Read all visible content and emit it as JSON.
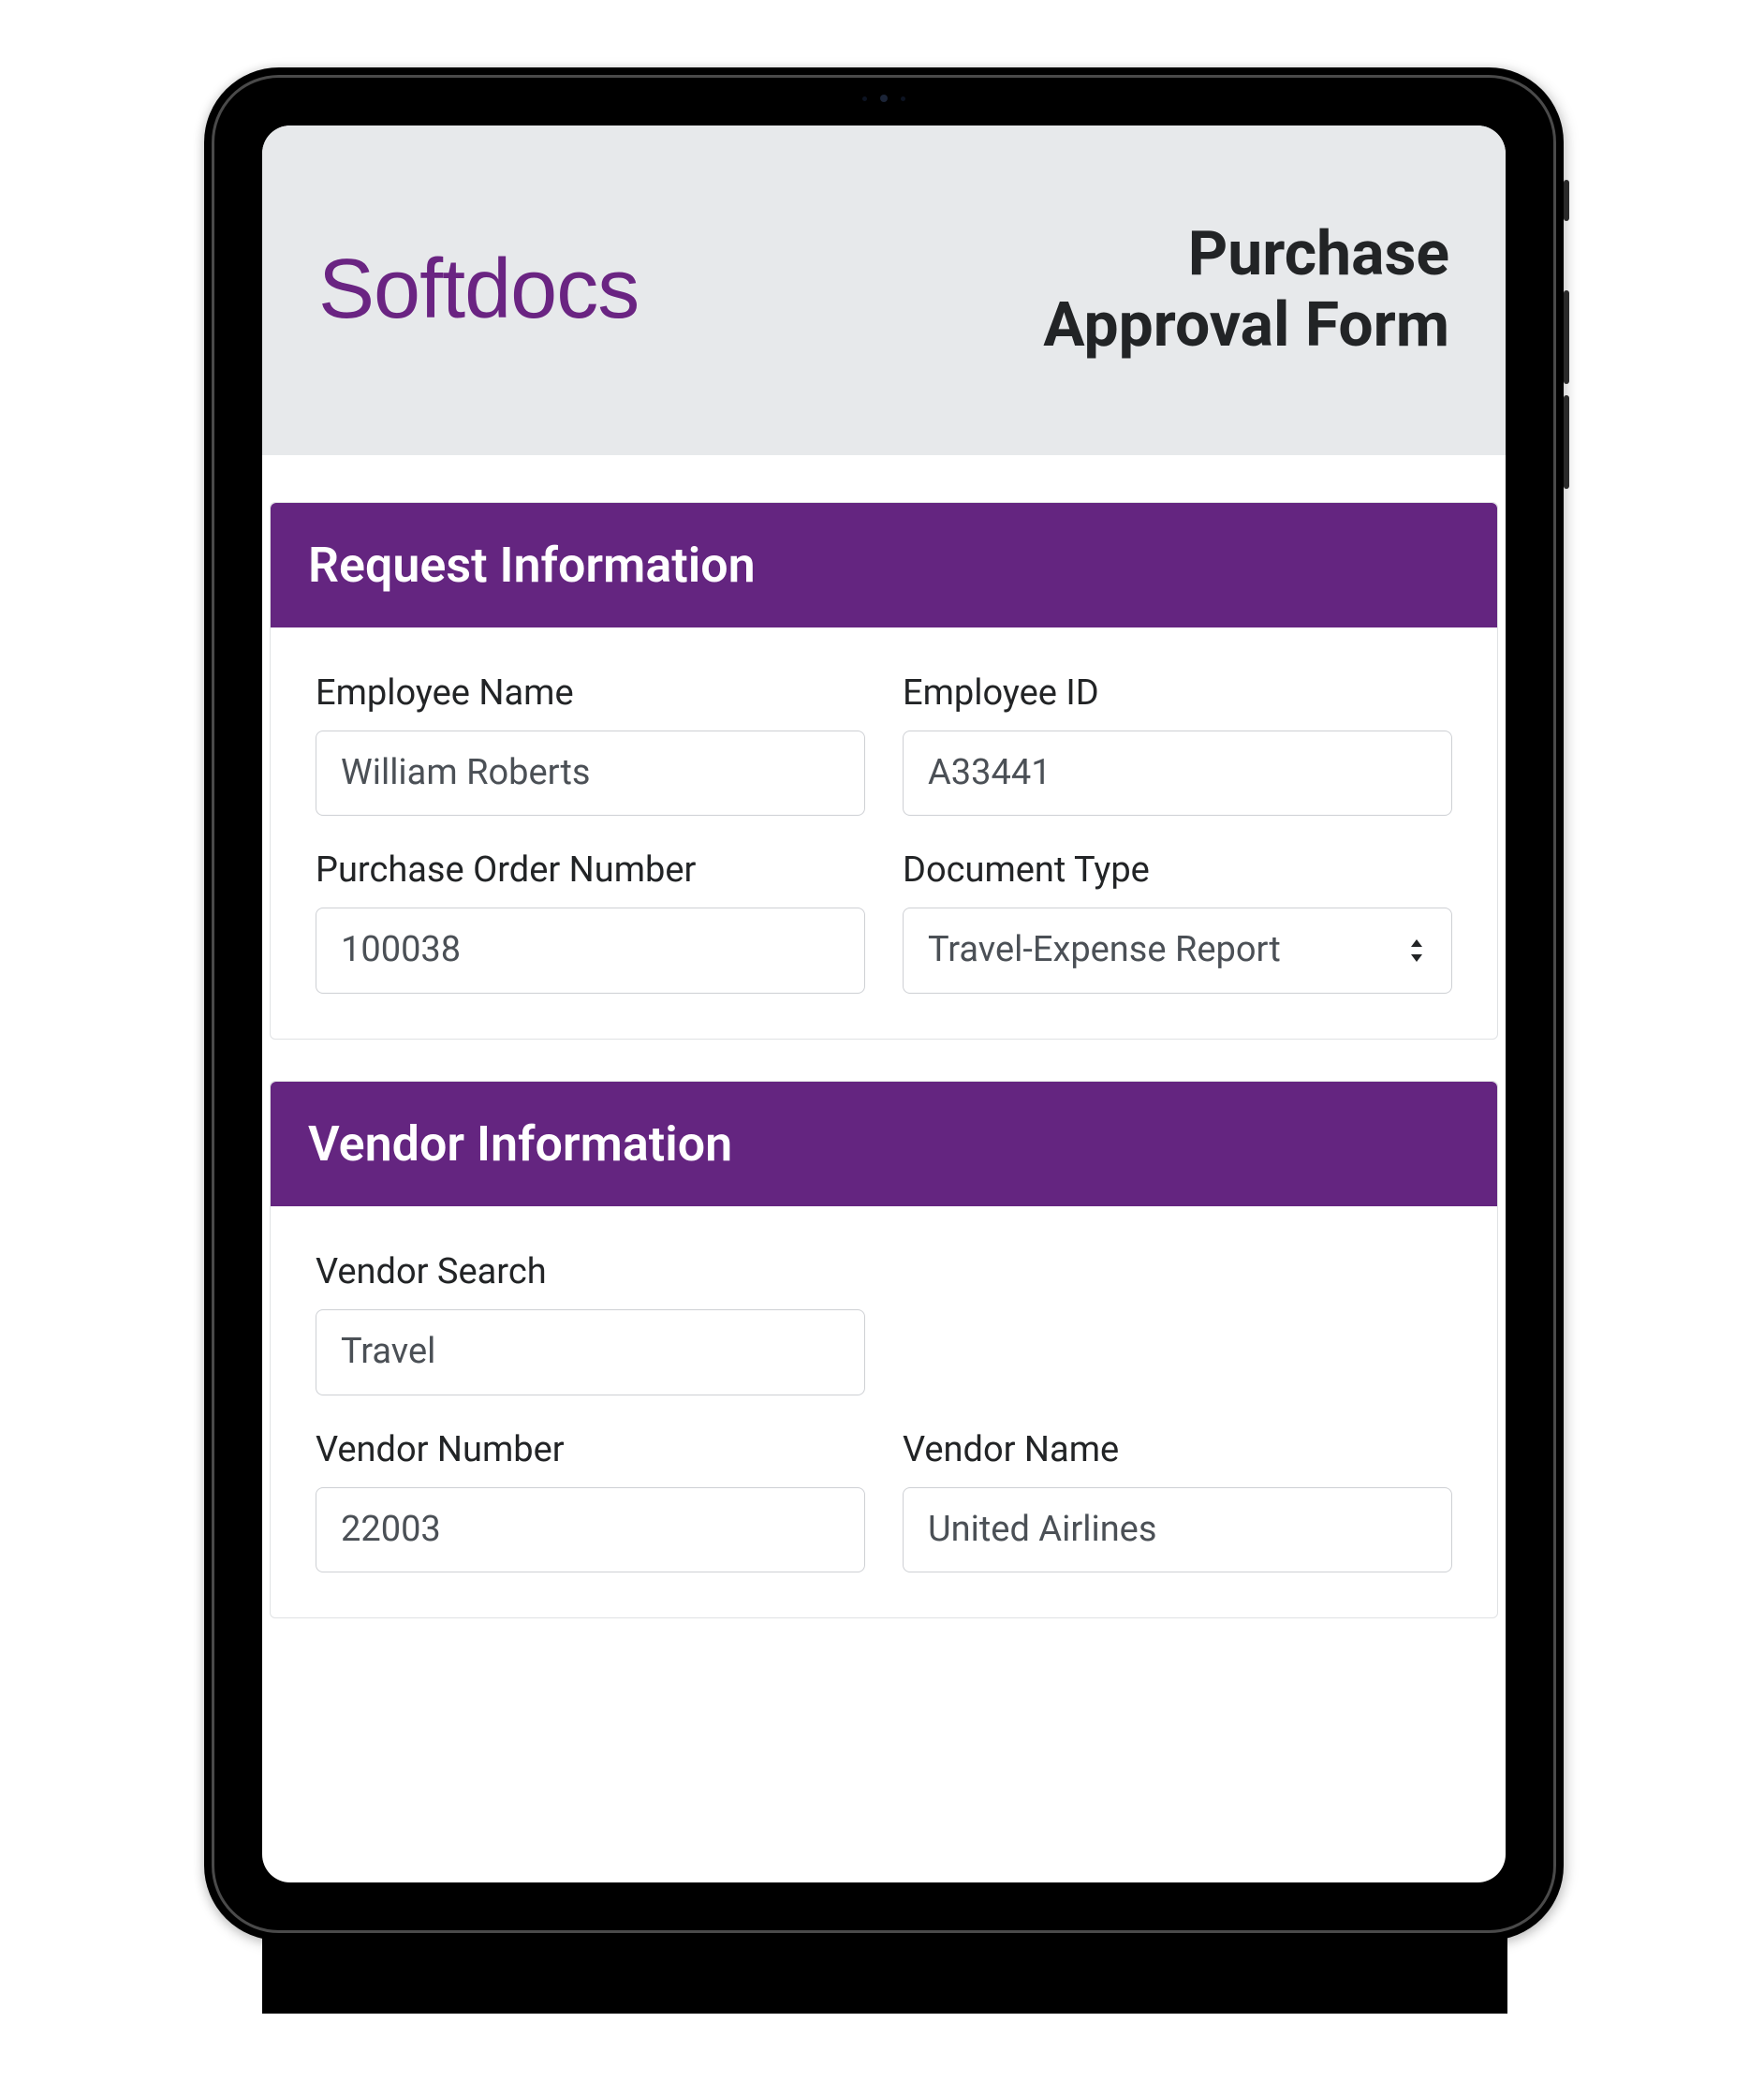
{
  "brand": {
    "name": "Softdocs",
    "color": "#6a2482"
  },
  "header": {
    "title_line1": "Purchase",
    "title_line2": "Approval Form"
  },
  "sections": {
    "request": {
      "heading": "Request Information",
      "fields": {
        "employee_name": {
          "label": "Employee Name",
          "value": "William Roberts"
        },
        "employee_id": {
          "label": "Employee ID",
          "value": "A33441"
        },
        "po_number": {
          "label": "Purchase Order Number",
          "value": "100038"
        },
        "doc_type": {
          "label": "Document Type",
          "value": "Travel-Expense Report"
        }
      }
    },
    "vendor": {
      "heading": "Vendor Information",
      "fields": {
        "vendor_search": {
          "label": "Vendor Search",
          "value": "Travel"
        },
        "vendor_number": {
          "label": "Vendor Number",
          "value": "22003"
        },
        "vendor_name": {
          "label": "Vendor Name",
          "value": "United Airlines"
        }
      }
    }
  },
  "colors": {
    "section_header_bg": "#642580",
    "header_bg": "#e7e9eb",
    "text_dark": "#222426",
    "input_border": "#ced0d4",
    "input_text": "#4b5056"
  }
}
